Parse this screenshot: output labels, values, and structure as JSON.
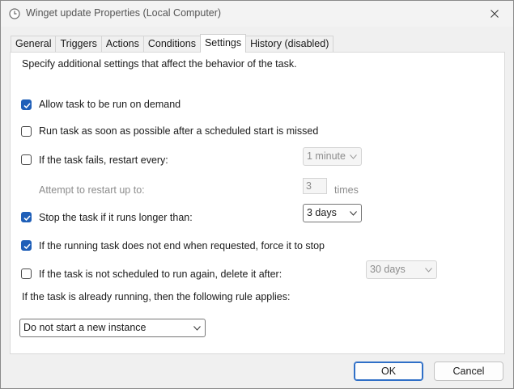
{
  "window": {
    "title": "Winget update Properties (Local Computer)"
  },
  "tabs": [
    {
      "label": "General"
    },
    {
      "label": "Triggers"
    },
    {
      "label": "Actions"
    },
    {
      "label": "Conditions"
    },
    {
      "label": "Settings",
      "active": true
    },
    {
      "label": "History (disabled)"
    }
  ],
  "settings": {
    "intro": "Specify additional settings that affect the behavior of the task.",
    "allow_on_demand": {
      "label": "Allow task to be run on demand",
      "checked": true
    },
    "run_asap": {
      "label": "Run task as soon as possible after a scheduled start is missed",
      "checked": false
    },
    "restart_on_fail": {
      "label": "If the task fails, restart every:",
      "checked": false,
      "interval": "1 minute"
    },
    "restart_attempts": {
      "label": "Attempt to restart up to:",
      "value": "3",
      "unit": "times"
    },
    "stop_if_longer": {
      "label": "Stop the task if it runs longer than:",
      "checked": true,
      "duration": "3 days"
    },
    "force_stop": {
      "label": "If the running task does not end when requested, force it to stop",
      "checked": true
    },
    "delete_after": {
      "label": "If the task is not scheduled to run again, delete it after:",
      "checked": false,
      "duration": "30 days"
    },
    "running_rule_label": "If the task is already running, then the following rule applies:",
    "running_rule_value": "Do not start a new instance"
  },
  "buttons": {
    "ok": "OK",
    "cancel": "Cancel"
  },
  "colors": {
    "accent": "#1f5fb8",
    "default_button_border": "#2f6fc7"
  }
}
